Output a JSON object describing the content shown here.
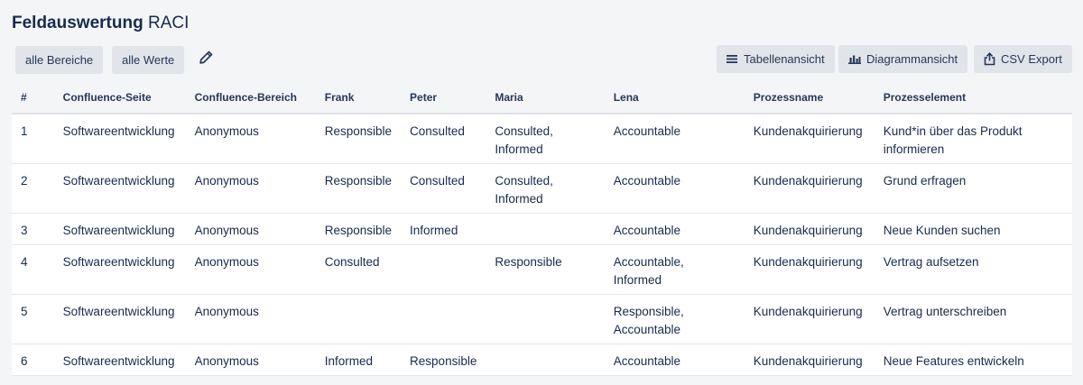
{
  "title": {
    "bold": "Feldauswertung",
    "light": "RACI"
  },
  "filters": {
    "areas_label": "alle Bereiche",
    "values_label": "alle Werte"
  },
  "views": {
    "table_label": "Tabellenansicht",
    "chart_label": "Diagrammansicht",
    "csv_label": "CSV Export"
  },
  "table": {
    "headers": [
      "#",
      "Confluence-Seite",
      "Confluence-Bereich",
      "Frank",
      "Peter",
      "Maria",
      "Lena",
      "Prozessname",
      "Prozesselement"
    ],
    "rows": [
      {
        "num": "1",
        "page": "Softwareentwicklung",
        "space": "Anonymous",
        "frank": "Responsible",
        "peter": "Consulted",
        "maria": "Consulted,\nInformed",
        "lena": "Accountable",
        "process": "Kundenakquirierung",
        "element": "Kund*in über das Produkt\ninformieren"
      },
      {
        "num": "2",
        "page": "Softwareentwicklung",
        "space": "Anonymous",
        "frank": "Responsible",
        "peter": "Consulted",
        "maria": "Consulted,\nInformed",
        "lena": "Accountable",
        "process": "Kundenakquirierung",
        "element": "Grund erfragen"
      },
      {
        "num": "3",
        "page": "Softwareentwicklung",
        "space": "Anonymous",
        "frank": "Responsible",
        "peter": "Informed",
        "maria": "",
        "lena": "Accountable",
        "process": "Kundenakquirierung",
        "element": "Neue Kunden suchen"
      },
      {
        "num": "4",
        "page": "Softwareentwicklung",
        "space": "Anonymous",
        "frank": "Consulted",
        "peter": "",
        "maria": "Responsible",
        "lena": "Accountable,\nInformed",
        "process": "Kundenakquirierung",
        "element": "Vertrag aufsetzen"
      },
      {
        "num": "5",
        "page": "Softwareentwicklung",
        "space": "Anonymous",
        "frank": "",
        "peter": "",
        "maria": "",
        "lena": "Responsible,\nAccountable",
        "process": "Kundenakquirierung",
        "element": "Vertrag unterschreiben"
      },
      {
        "num": "6",
        "page": "Softwareentwicklung",
        "space": "Anonymous",
        "frank": "Informed",
        "peter": "Responsible",
        "maria": "",
        "lena": "Accountable",
        "process": "Kundenakquirierung",
        "element": "Neue Features entwickeln"
      }
    ]
  },
  "icons": {
    "edit": "pencil-icon",
    "table_view": "list-icon",
    "chart_view": "bar-chart-icon",
    "csv": "export-icon"
  },
  "colors": {
    "link": "#1e5fa8",
    "button_bg": "#e1e4e9",
    "background": "#f4f5f7",
    "text": "#172b4d"
  }
}
